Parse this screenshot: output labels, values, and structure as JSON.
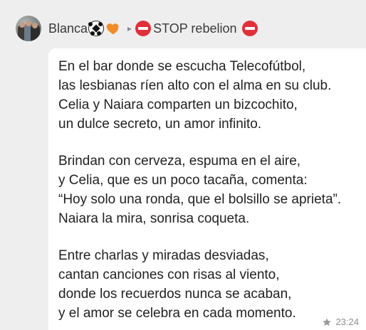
{
  "header": {
    "sender_name": "Blanca",
    "sender_emojis": [
      "soccer-ball",
      "orange-heart"
    ],
    "arrow": "▸",
    "channel_name": "STOP rebelion",
    "channel_emoji": "no-entry"
  },
  "message": {
    "paragraphs": [
      [
        "En el bar donde se escucha Telecofútbol,",
        "las lesbianas ríen alto con el alma en su club.",
        "Celia y Naiara comparten un bizcochito,",
        "un dulce secreto, un amor infinito."
      ],
      [
        "Brindan con cerveza, espuma en el aire,",
        "y Celia, que es un poco tacaña, comenta:",
        "“Hoy solo una ronda, que el bolsillo se aprieta”.",
        "Naiara la mira, sonrisa coqueta."
      ],
      [
        "Entre charlas y miradas desviadas,",
        "cantan canciones con risas al viento,",
        "donde los recuerdos nunca se acaban,",
        "y el amor se celebra en cada momento."
      ]
    ],
    "time": "23:24",
    "status_icon": "star-icon"
  },
  "colors": {
    "background": "#eeeeee",
    "bubble": "#ffffff",
    "text": "#222222",
    "meta": "#8f8f8f",
    "stop_red": "#e0303b",
    "heart_orange": "#f28c28"
  }
}
